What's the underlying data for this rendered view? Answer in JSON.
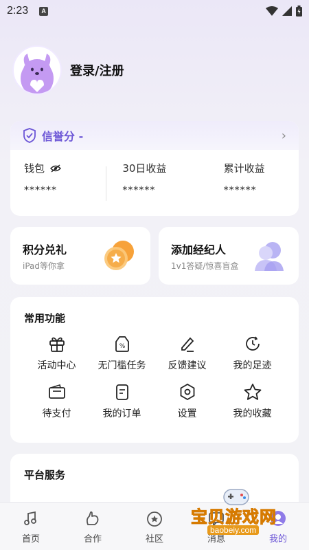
{
  "status_bar": {
    "time": "2:23",
    "app_badge": "A"
  },
  "profile": {
    "login_label": "登录/注册"
  },
  "credit": {
    "title": "信誉分 -",
    "columns": [
      {
        "label": "钱包",
        "value": "******"
      },
      {
        "label": "30日收益",
        "value": "******"
      },
      {
        "label": "累计收益",
        "value": "******"
      }
    ]
  },
  "promos": [
    {
      "title": "积分兑礼",
      "subtitle": "iPad等你拿"
    },
    {
      "title": "添加经纪人",
      "subtitle": "1v1答疑/惊喜盲盒"
    }
  ],
  "common_functions": {
    "title": "常用功能",
    "items": [
      {
        "label": "活动中心",
        "icon": "gift-icon"
      },
      {
        "label": "无门槛任务",
        "icon": "discount-tag-icon"
      },
      {
        "label": "反馈建议",
        "icon": "pen-icon"
      },
      {
        "label": "我的足迹",
        "icon": "clock-icon"
      },
      {
        "label": "待支付",
        "icon": "wallet-icon"
      },
      {
        "label": "我的订单",
        "icon": "order-list-icon"
      },
      {
        "label": "设置",
        "icon": "settings-hexagon-icon"
      },
      {
        "label": "我的收藏",
        "icon": "star-icon"
      }
    ]
  },
  "platform_services": {
    "title": "平台服务"
  },
  "tabbar": {
    "tabs": [
      {
        "label": "首页",
        "icon": "home-music-icon"
      },
      {
        "label": "合作",
        "icon": "cooperation-icon"
      },
      {
        "label": "社区",
        "icon": "community-icon"
      },
      {
        "label": "消息",
        "icon": "message-icon"
      },
      {
        "label": "我的",
        "icon": "mine-icon"
      }
    ],
    "active_index": 4
  },
  "watermark": {
    "text": "宝贝游戏网",
    "url": "baobeiy.com"
  },
  "colors": {
    "accent": "#6b55d6",
    "background": "#f2f2f6",
    "card": "#ffffff"
  }
}
